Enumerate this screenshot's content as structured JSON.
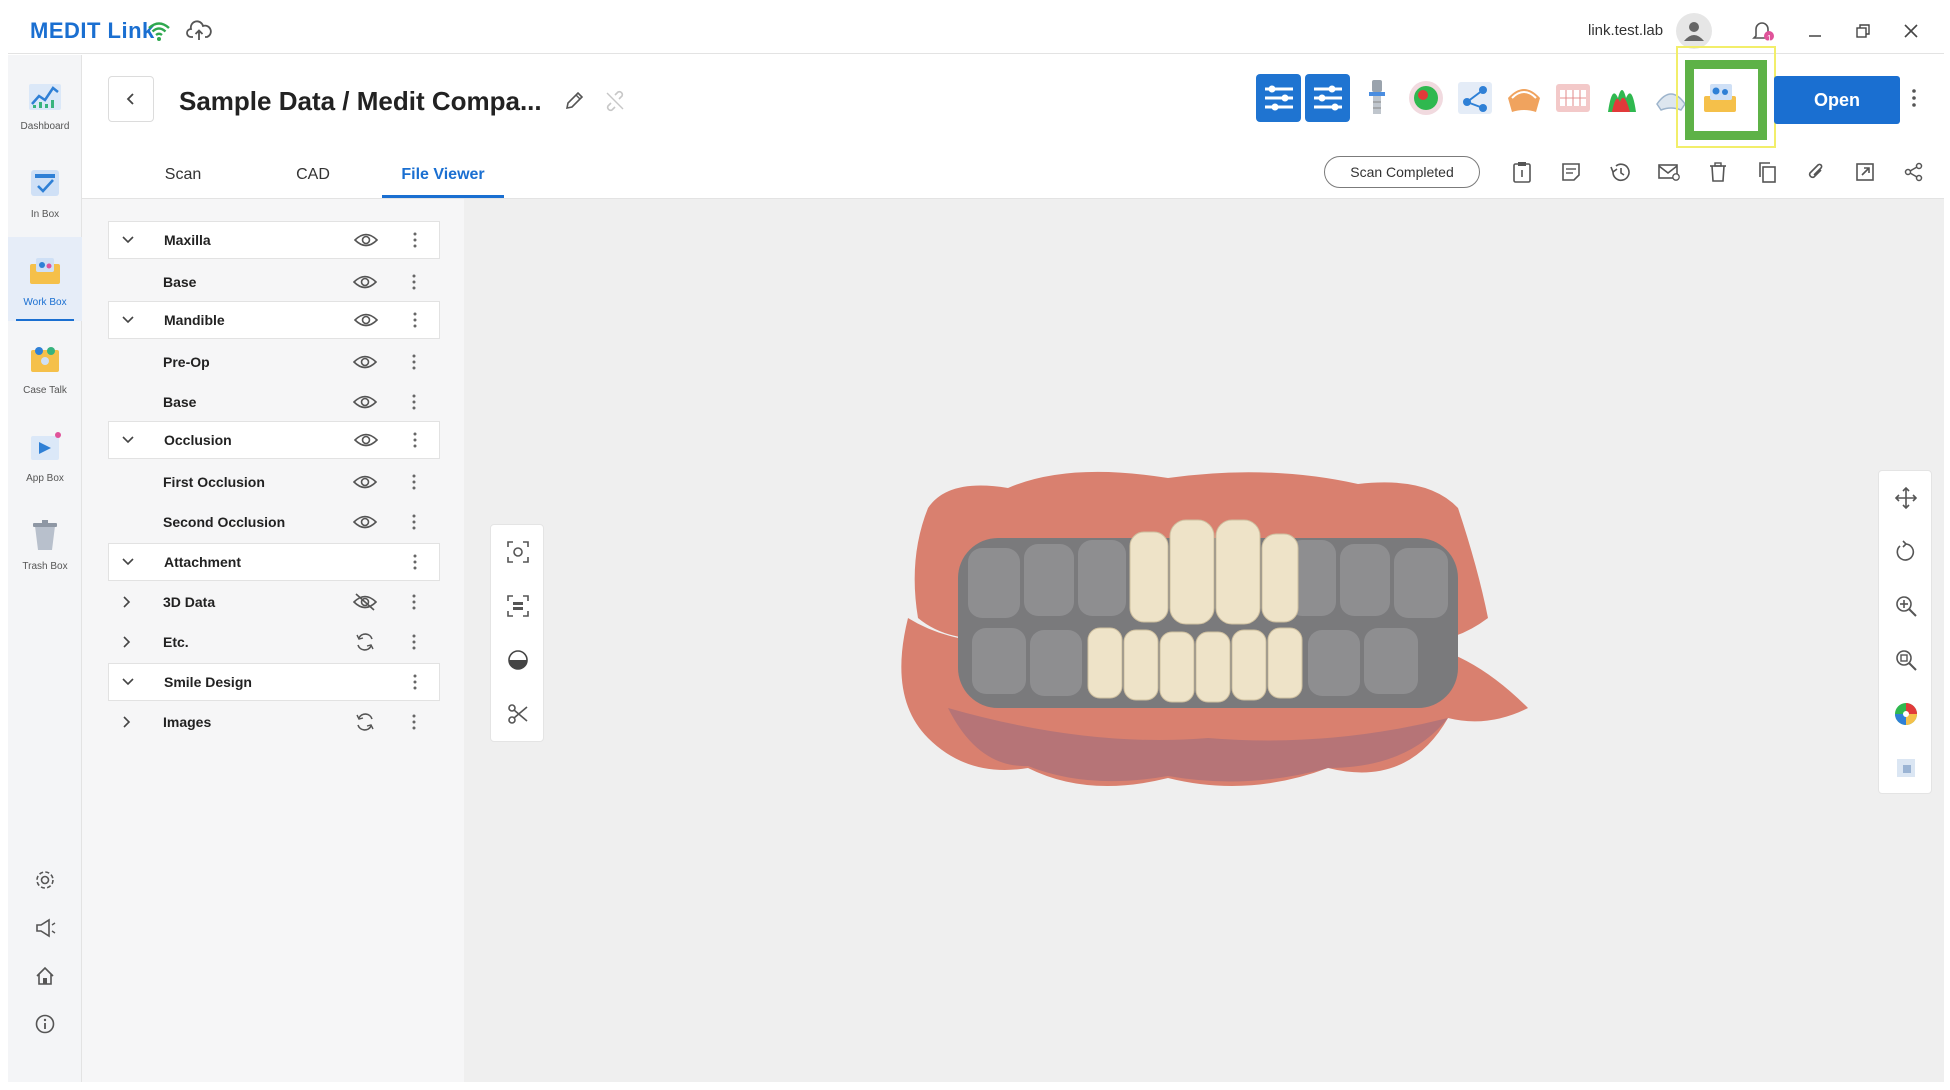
{
  "app": {
    "brand": "MEDIT Link"
  },
  "titlebar": {
    "user_name": "link.test.lab",
    "notification_count": "1"
  },
  "leftnav": {
    "items": [
      {
        "label": "Dashboard",
        "icon": "dashboard-icon"
      },
      {
        "label": "In Box",
        "icon": "inbox-icon"
      },
      {
        "label": "Work Box",
        "icon": "workbox-icon",
        "active": true
      },
      {
        "label": "Case Talk",
        "icon": "casetalk-icon"
      },
      {
        "label": "App Box",
        "icon": "appbox-icon"
      },
      {
        "label": "Trash Box",
        "icon": "trashbox-icon"
      }
    ],
    "utility_icons": [
      "settings-icon",
      "announcement-icon",
      "home-icon",
      "info-icon"
    ]
  },
  "header": {
    "case_title": "Sample Data / Medit Compa...",
    "open_label": "Open",
    "app_tiles": [
      "app-settings-1-icon",
      "app-settings-2-icon",
      "scanbody-app-icon",
      "color-map-app-icon",
      "workflow-app-icon",
      "model-builder-app-icon",
      "smile-design-app-icon",
      "deviation-app-icon",
      "clear-aligner-app-icon",
      "order-suite-app-icon"
    ]
  },
  "tabs": [
    {
      "label": "Scan"
    },
    {
      "label": "CAD"
    },
    {
      "label": "File Viewer",
      "active": true
    }
  ],
  "status": {
    "label": "Scan Completed"
  },
  "tree": [
    {
      "name": "Maxilla",
      "type": "group",
      "expanded": true,
      "visibility": "eye-icon"
    },
    {
      "name": "Base",
      "type": "child",
      "visibility": "eye-icon"
    },
    {
      "name": "Mandible",
      "type": "group",
      "expanded": true,
      "visibility": "eye-icon"
    },
    {
      "name": "Pre-Op",
      "type": "child",
      "visibility": "eye-icon"
    },
    {
      "name": "Base",
      "type": "child",
      "visibility": "eye-icon"
    },
    {
      "name": "Occlusion",
      "type": "group",
      "expanded": true,
      "visibility": "eye-icon"
    },
    {
      "name": "First Occlusion",
      "type": "child",
      "visibility": "eye-icon"
    },
    {
      "name": "Second Occlusion",
      "type": "child",
      "visibility": "eye-icon"
    },
    {
      "name": "Attachment",
      "type": "group",
      "expanded": true,
      "visibility": ""
    },
    {
      "name": "3D Data",
      "type": "subgroup",
      "expanded": false,
      "visibility": "eye-hidden-icon"
    },
    {
      "name": "Etc.",
      "type": "subgroup",
      "expanded": false,
      "visibility": "sync-icon"
    },
    {
      "name": "Smile Design",
      "type": "group",
      "expanded": true,
      "visibility": ""
    },
    {
      "name": "Images",
      "type": "subgroup",
      "expanded": false,
      "visibility": "sync-icon"
    }
  ],
  "colors": {
    "accent": "#1a6fd1",
    "highlight_green": "#5eb247",
    "highlight_yellow": "#f2ee6a"
  }
}
